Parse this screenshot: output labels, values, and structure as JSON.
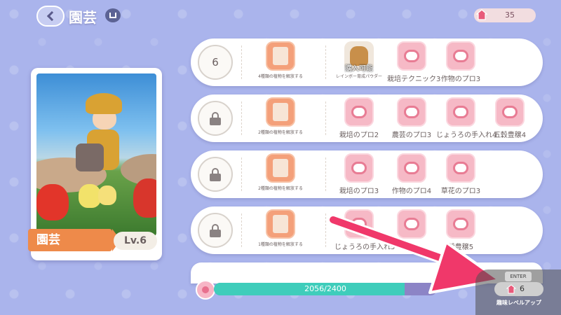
{
  "header": {
    "title": "園芸",
    "currency_value": "35"
  },
  "card": {
    "name": "園芸",
    "level": "Lv.6"
  },
  "rows": [
    {
      "badge": "6",
      "locked": false,
      "unlock_text": "4種類の植物を解放する",
      "items": [
        {
          "kind": "bag",
          "label": "レインボー育成パウダー",
          "tag": "購入可能",
          "small": true
        },
        {
          "kind": "scroll",
          "label": "栽培テクニック3"
        },
        {
          "kind": "scroll",
          "label": "作物のプロ3"
        }
      ]
    },
    {
      "badge": "",
      "locked": true,
      "unlock_text": "2種類の植物を解放する",
      "items": [
        {
          "kind": "scroll",
          "label": "栽培のプロ2"
        },
        {
          "kind": "scroll",
          "label": "農芸のプロ3"
        },
        {
          "kind": "scroll",
          "label": "じょうろの手入れ4"
        },
        {
          "kind": "scroll",
          "label": "五穀豊穣4"
        }
      ]
    },
    {
      "badge": "",
      "locked": true,
      "unlock_text": "2種類の植物を解放する",
      "items": [
        {
          "kind": "scroll",
          "label": "栽培のプロ3"
        },
        {
          "kind": "scroll",
          "label": "作物のプロ4"
        },
        {
          "kind": "scroll",
          "label": "草花のプロ3"
        }
      ]
    },
    {
      "badge": "",
      "locked": true,
      "unlock_text": "1種類の植物を解放する",
      "items": [
        {
          "kind": "scroll",
          "label": "じょうろの手入れ5"
        },
        {
          "kind": "scroll",
          "label": "ク4"
        },
        {
          "kind": "scroll",
          "label": "穀豊穣5"
        }
      ]
    }
  ],
  "progress": {
    "text": "2056/2400",
    "current": 2056,
    "max": 2400
  },
  "levelup": {
    "key": "ENTER",
    "cost": "6",
    "label": "趣味レベルアップ"
  },
  "colors": {
    "background": "#aab4ec",
    "accent_orange": "#ee8a4a",
    "progress_fill": "#3fcdbb",
    "arrow": "#f0386a"
  }
}
